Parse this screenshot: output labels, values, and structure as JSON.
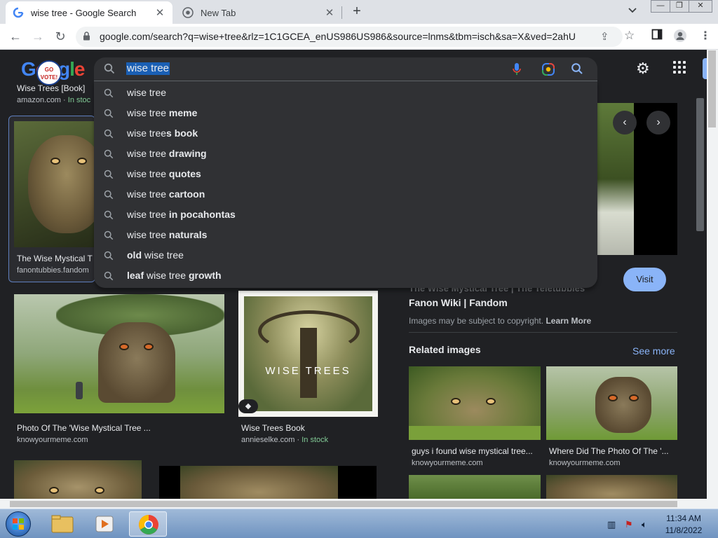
{
  "browser": {
    "tabs": [
      {
        "title": "wise tree - Google Search",
        "favicon": "google-g-icon"
      },
      {
        "title": "New Tab",
        "favicon": "chrome-icon"
      }
    ],
    "url": "google.com/search?q=wise+tree&rlz=1C1GCEA_enUS986US986&source=lnms&tbm=isch&sa=X&ved=2ahUKE..."
  },
  "header": {
    "logo_letters": [
      "G",
      "o",
      "o",
      "g",
      "l",
      "e"
    ],
    "badge_text": "GO VOTE!",
    "query": "wise tree"
  },
  "suggestions": [
    {
      "normal": "wise tree",
      "bold": ""
    },
    {
      "normal": "wise tree ",
      "bold": "meme"
    },
    {
      "normal": "wise tree",
      "bold": "s book"
    },
    {
      "normal": "wise tree ",
      "bold": "drawing"
    },
    {
      "normal": "wise tree ",
      "bold": "quotes"
    },
    {
      "normal": "wise tree ",
      "bold": "cartoon"
    },
    {
      "normal": "wise tree ",
      "bold": "in pocahontas"
    },
    {
      "normal": "wise tree ",
      "bold": "naturals"
    },
    {
      "prefix_bold": "old ",
      "normal": "wise tree"
    },
    {
      "prefix_bold": "leaf ",
      "normal": "wise tree ",
      "bold": "growth"
    }
  ],
  "results": {
    "top_partial": {
      "title": "Wise Trees [Book]",
      "source": "amazon.com",
      "stock": "In stoc"
    },
    "selected": {
      "title": "The Wise Mystical T",
      "source": "fanontubbies.fandom"
    },
    "row2": [
      {
        "title": "Photo Of The 'Wise Mystical Tree ...",
        "source": "knowyourmeme.com",
        "stock": ""
      },
      {
        "title": "Wise Trees Book",
        "source": "annieselke.com",
        "stock": "In stock",
        "cover_text": "WISE TREES"
      }
    ]
  },
  "panel": {
    "faded_title": "The Wise Mystical Tree | The Teletubbies",
    "title": "Fanon Wiki | Fandom",
    "visit_label": "Visit",
    "copyright_text": "Images may be subject to copyright.",
    "learn_more": "Learn More",
    "related_label": "Related images",
    "see_more": "See more",
    "related": [
      {
        "title": "guys i found wise mystical tree...",
        "source": "knowyourmeme.com"
      },
      {
        "title": "Where Did The Photo Of The '...",
        "source": "knowyourmeme.com"
      }
    ]
  },
  "taskbar": {
    "time": "11:34 AM",
    "date": "11/8/2022"
  },
  "colors": {
    "page_bg": "#202124",
    "surface": "#303134",
    "link_blue": "#8ab4f8",
    "stock_green": "#81c995"
  }
}
